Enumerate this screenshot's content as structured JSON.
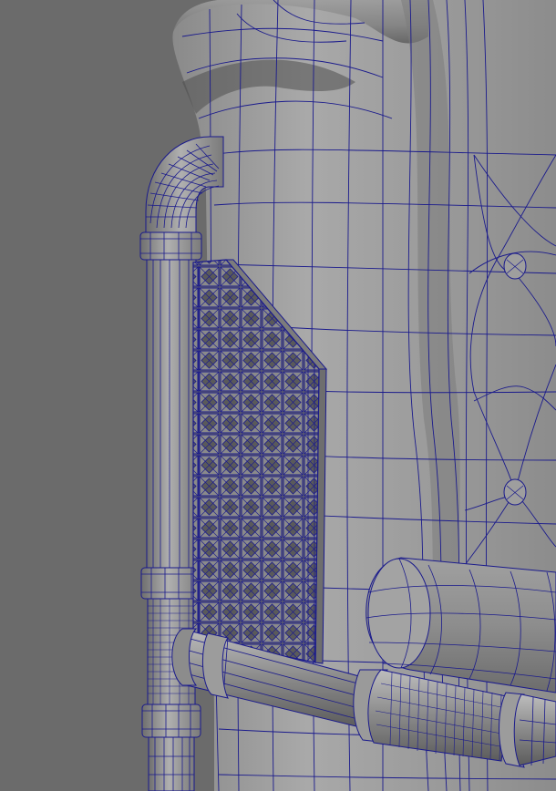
{
  "viewport": {
    "background_color": "#6b6b6b",
    "wire_color": "#1a1a8c",
    "surface_light": "#a8a8a8",
    "surface_mid": "#8e8e8e",
    "surface_dark": "#5a5a5a"
  },
  "scene": {
    "objects": [
      {
        "name": "chair-backrest-mesh",
        "shading": "wireframe-on-shaded"
      },
      {
        "name": "pipe-frame-vertical-mesh",
        "shading": "wireframe-on-shaded"
      },
      {
        "name": "lattice-side-panel-mesh",
        "shading": "wireframe-on-shaded"
      },
      {
        "name": "pipe-frame-horizontal-mesh",
        "shading": "wireframe-on-shaded"
      },
      {
        "name": "armrest-cushion-mesh",
        "shading": "wireframe-on-shaded"
      }
    ]
  }
}
